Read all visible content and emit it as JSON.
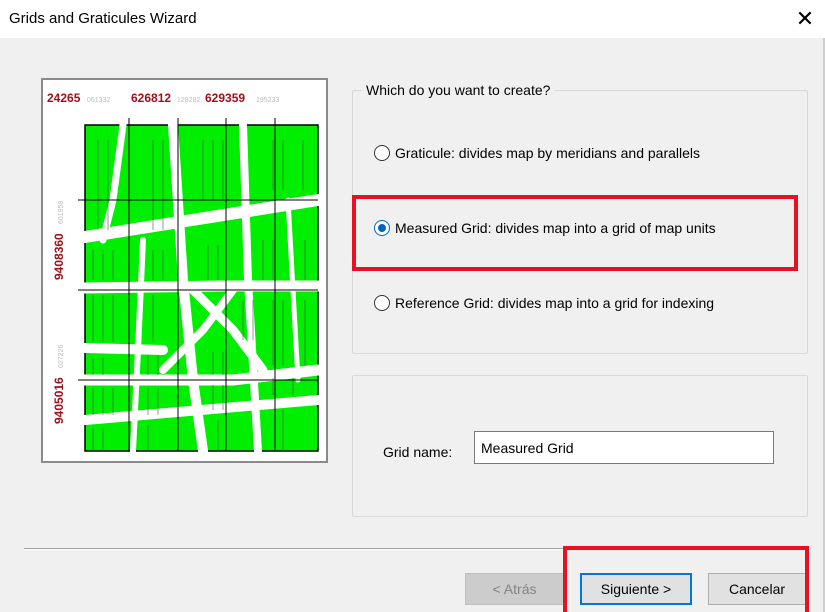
{
  "window": {
    "title": "Grids and Graticules Wizard",
    "close_glyph": "✕"
  },
  "preview": {
    "top_coords": [
      {
        "value": "24265",
        "suffix": "061332"
      },
      {
        "value": "626812",
        "suffix": "128282"
      },
      {
        "value": "629359",
        "suffix": "195233"
      }
    ],
    "left_coords": [
      {
        "value": "9408360",
        "suffix": "601958"
      },
      {
        "value": "9405016",
        "suffix": "027226"
      }
    ],
    "colors": {
      "fill": "#00ee00",
      "coord_text": "#a0101a",
      "coord_suffix": "#bdbdbd"
    }
  },
  "create_group": {
    "legend": "Which do you want to create?",
    "options": [
      {
        "label": "Graticule: divides map by meridians and parallels",
        "checked": false
      },
      {
        "label": "Measured Grid: divides map into a grid of map units",
        "checked": true
      },
      {
        "label": "Reference Grid: divides map into a grid for indexing",
        "checked": false
      }
    ]
  },
  "name_group": {
    "label": "Grid name:",
    "value": "Measured Grid"
  },
  "buttons": {
    "back": "< Atrás",
    "next": "Siguiente >",
    "cancel": "Cancelar"
  },
  "colors": {
    "highlight": "#e81123",
    "accent": "#0067c0"
  }
}
